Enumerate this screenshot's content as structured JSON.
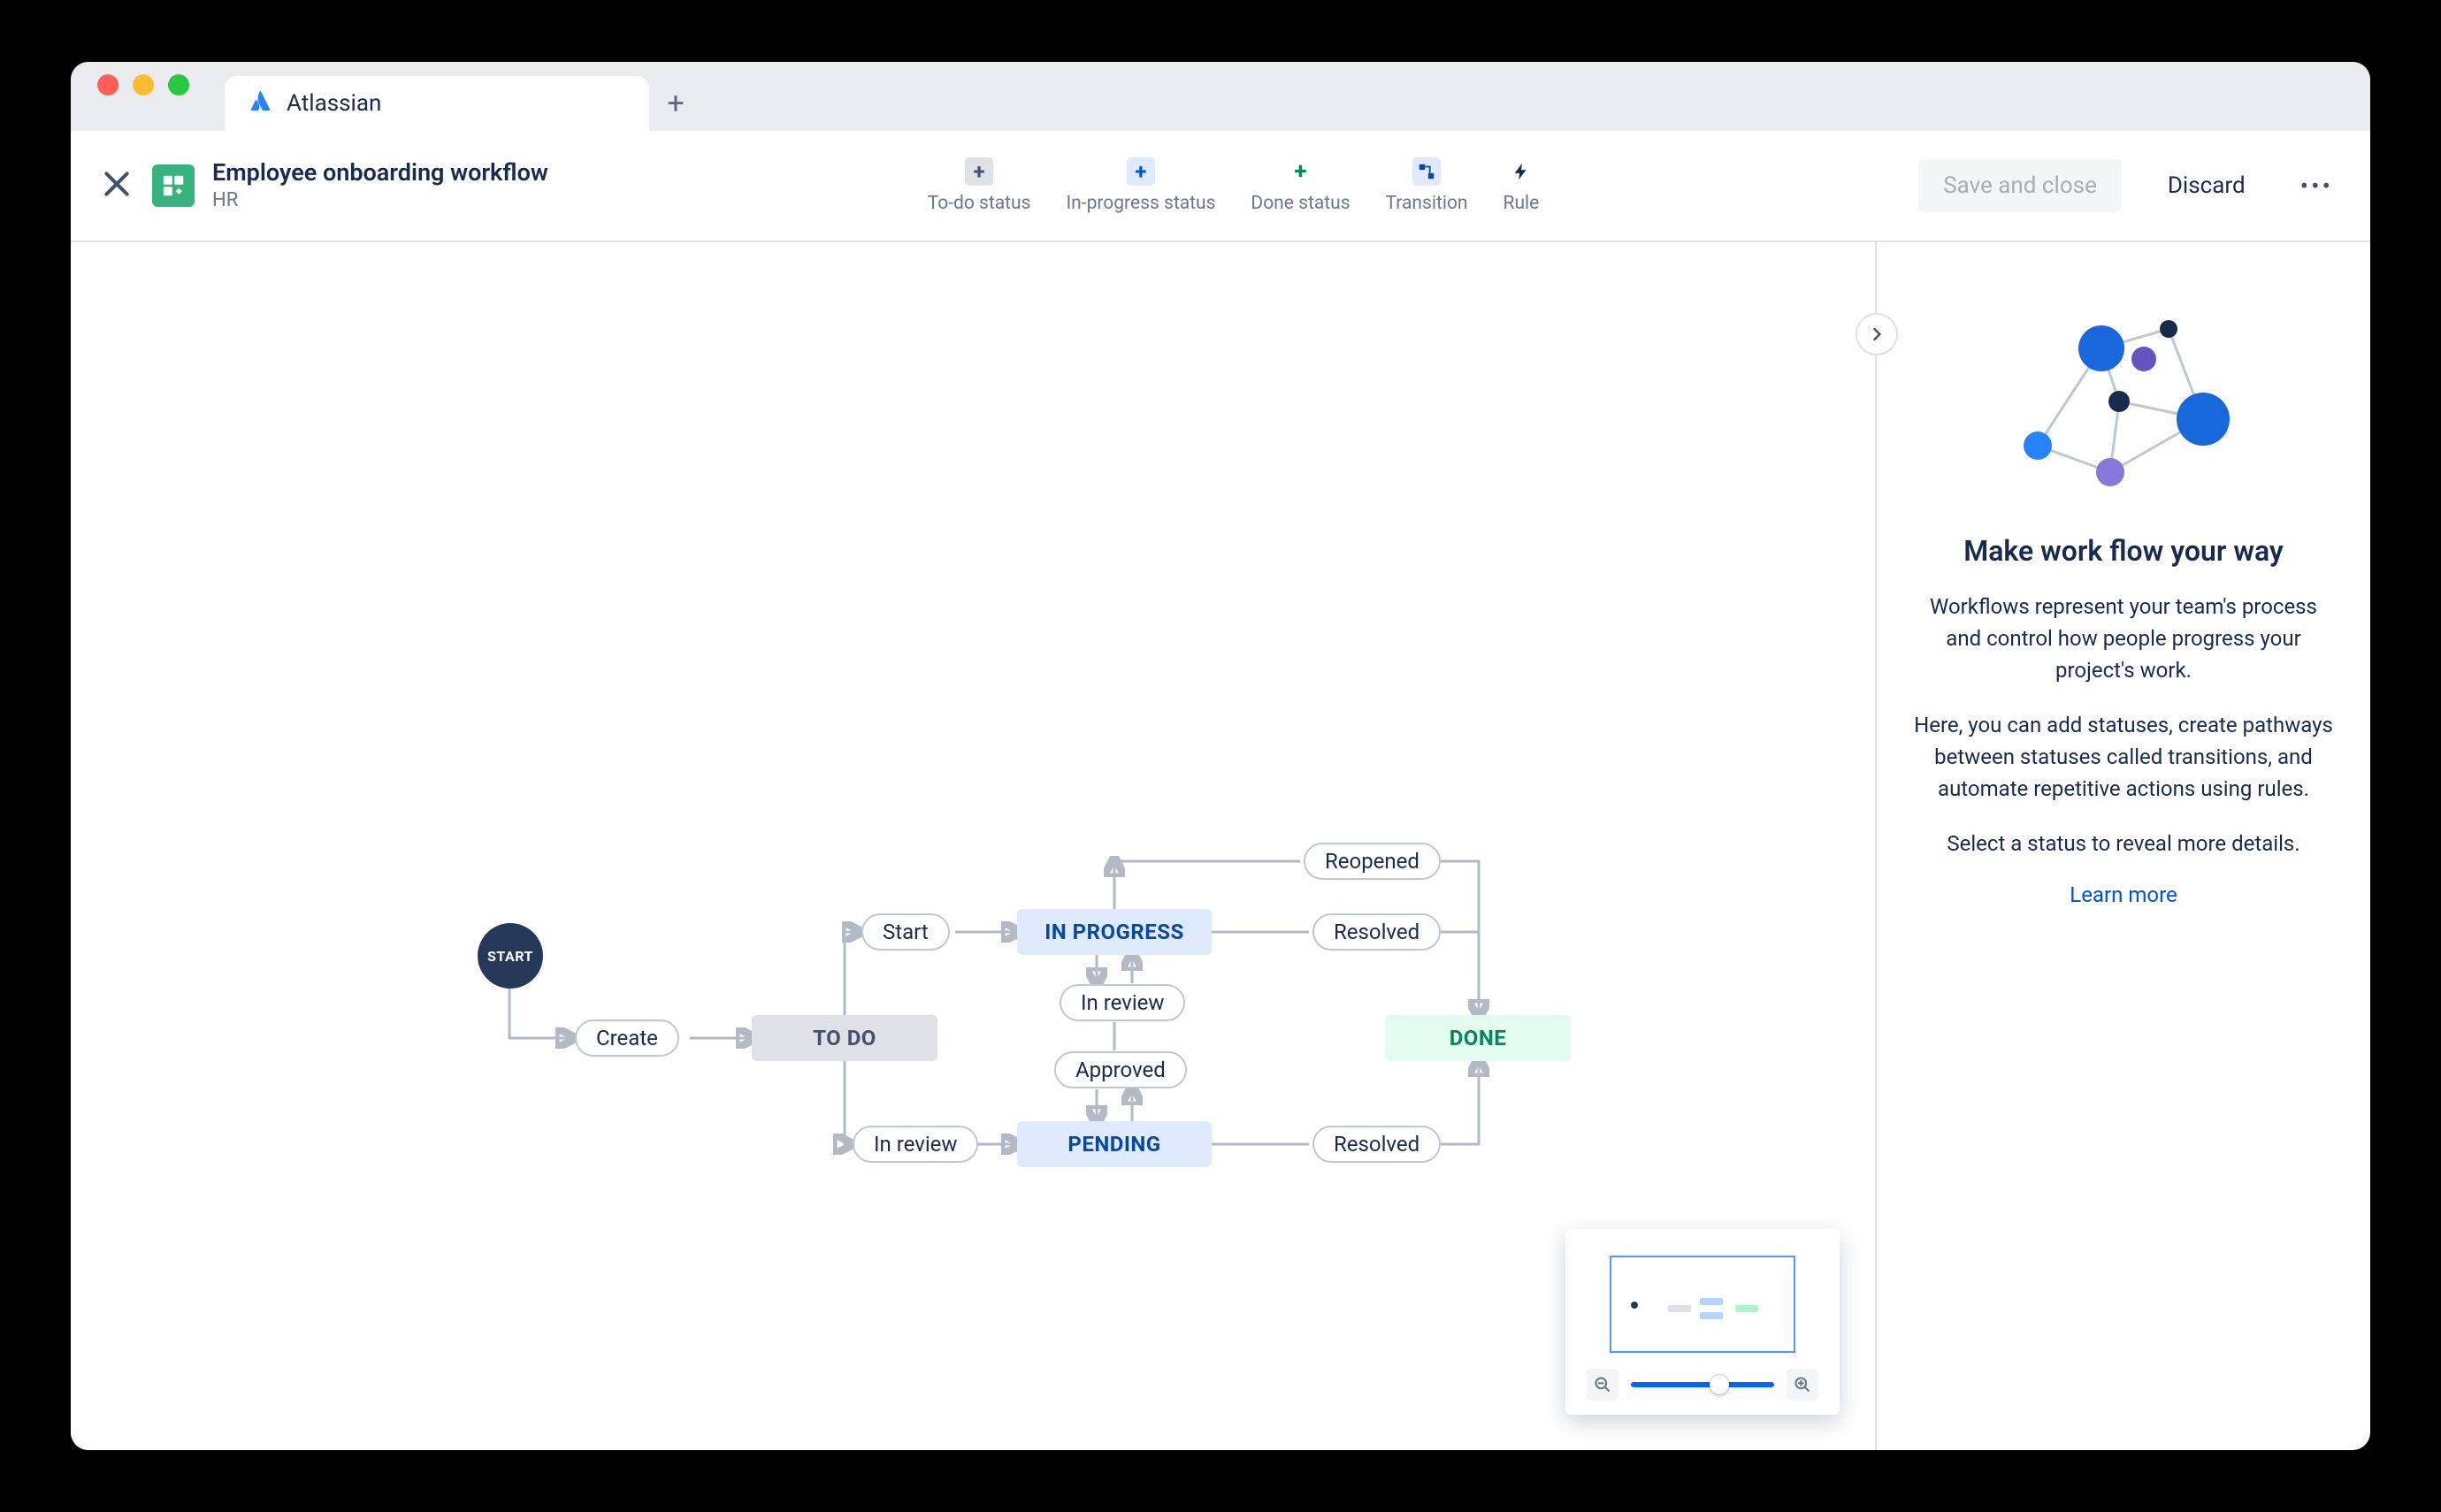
{
  "browser": {
    "tab_title": "Atlassian"
  },
  "header": {
    "workflow_title": "Employee onboarding workflow",
    "project_name": "HR",
    "toolbar": {
      "todo": "To-do status",
      "inprogress": "In-progress status",
      "done": "Done status",
      "transition": "Transition",
      "rule": "Rule"
    },
    "save_label": "Save and close",
    "discard_label": "Discard"
  },
  "workflow": {
    "start_label": "START",
    "statuses": {
      "todo": "TO DO",
      "in_progress": "IN PROGRESS",
      "pending": "PENDING",
      "done": "DONE"
    },
    "transitions": {
      "create": "Create",
      "start": "Start",
      "in_review_top": "In review",
      "approved": "Approved",
      "in_review_left": "In review",
      "reopened": "Reopened",
      "resolved_top": "Resolved",
      "resolved_bottom": "Resolved"
    }
  },
  "sidepanel": {
    "heading": "Make work flow your way",
    "p1": "Workflows represent your team's process and control how people progress your project's work.",
    "p2": "Here, you can add statuses, create pathways between statuses called transitions, and automate repetitive actions using rules.",
    "p3": "Select a status to reveal more details.",
    "learn_more": "Learn more"
  },
  "colors": {
    "accent_blue": "#0052CC",
    "status_todo_bg": "#DFE1E6",
    "status_inprogress_bg": "#DEEBFF",
    "status_done_bg": "#E3FCEF"
  }
}
